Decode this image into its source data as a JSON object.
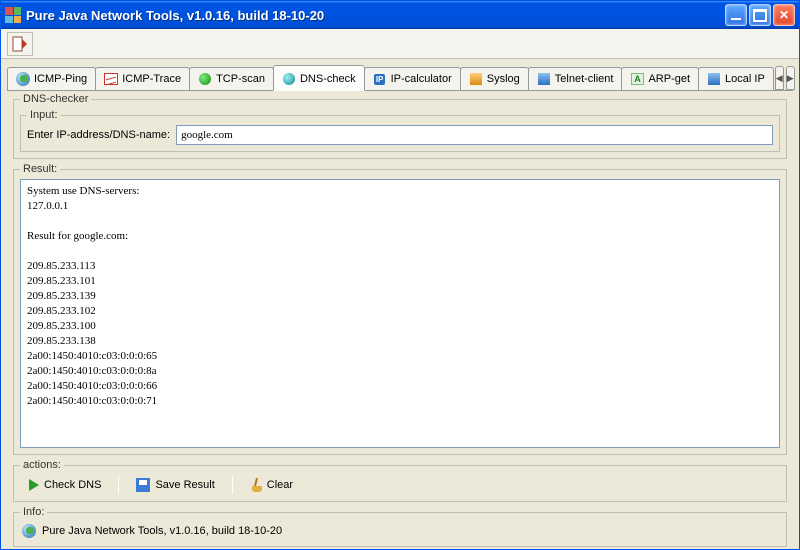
{
  "window": {
    "title": "Pure Java Network Tools,  v1.0.16, build 18-10-20"
  },
  "tabs": [
    {
      "label": "ICMP-Ping",
      "icon": "globe-icon"
    },
    {
      "label": "ICMP-Trace",
      "icon": "chart-icon"
    },
    {
      "label": "TCP-scan",
      "icon": "dot-green-icon"
    },
    {
      "label": "DNS-check",
      "icon": "dot-teal-icon"
    },
    {
      "label": "IP-calculator",
      "icon": "ip-badge-icon"
    },
    {
      "label": "Syslog",
      "icon": "doc-icon"
    },
    {
      "label": "Telnet-client",
      "icon": "terminal-icon"
    },
    {
      "label": "ARP-get",
      "icon": "arp-icon"
    },
    {
      "label": "Local IP",
      "icon": "nic-icon"
    }
  ],
  "active_tab_index": 3,
  "panel": {
    "title": "DNS-checker",
    "input_section": "Input:",
    "input_label": "Enter IP-address/DNS-name:",
    "input_value": "google.com",
    "result_section": "Result:",
    "actions_section": "actions:",
    "info_section": "Info:"
  },
  "result_lines": [
    "System use DNS-servers:",
    "127.0.0.1",
    "",
    "Result for google.com:",
    "",
    "209.85.233.113",
    "209.85.233.101",
    "209.85.233.139",
    "209.85.233.102",
    "209.85.233.100",
    "209.85.233.138",
    "2a00:1450:4010:c03:0:0:0:65",
    "2a00:1450:4010:c03:0:0:0:8a",
    "2a00:1450:4010:c03:0:0:0:66",
    "2a00:1450:4010:c03:0:0:0:71"
  ],
  "actions": {
    "check": "Check DNS",
    "save": "Save Result",
    "clear": "Clear"
  },
  "info_text": "Pure Java Network Tools,  v1.0.16, build 18-10-20"
}
